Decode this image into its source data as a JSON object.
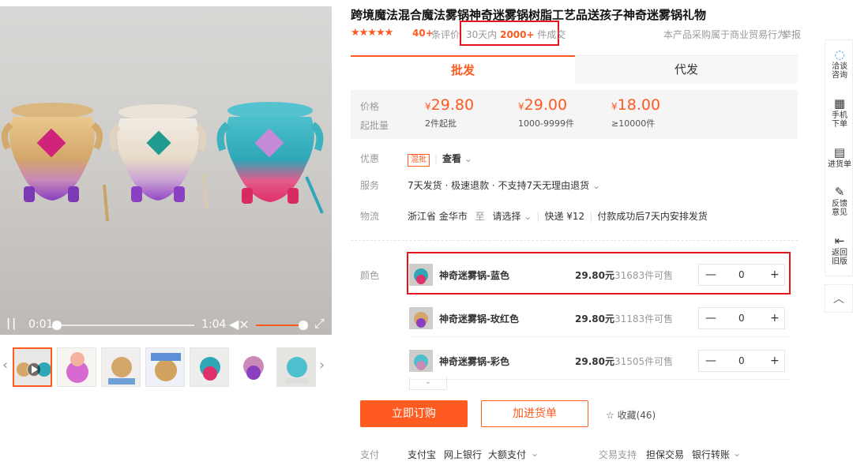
{
  "video": {
    "time_current": "0:01",
    "time_total": "1:04",
    "pause_glyph": "||",
    "volume_glyph": "◀×",
    "fullscreen_glyph": "⤢"
  },
  "thumbnails": {
    "count": 7,
    "prev": "‹",
    "next": "›"
  },
  "product": {
    "title": "跨境魔法混合魔法雾锅神奇迷雾锅树脂工艺品送孩子神奇迷雾锅礼物",
    "stars": "★★★★★",
    "review_count": "40+",
    "review_label": "条评价",
    "sales_prefix": "30天内",
    "sales_count": "2000+",
    "sales_suffix": "件成交",
    "notice": "本产品采购属于商业贸易行为",
    "report": "举报"
  },
  "tabs": {
    "wholesale": "批发",
    "dropship": "代发"
  },
  "pricing": {
    "price_label": "价格",
    "moq_label": "起批量",
    "currency": "¥",
    "tiers": [
      {
        "price": "29.80",
        "qty": "2件起批"
      },
      {
        "price": "29.00",
        "qty": "1000-9999件"
      },
      {
        "price": "18.00",
        "qty": "≥10000件"
      }
    ]
  },
  "promo": {
    "label": "优惠",
    "tag": "混批",
    "view": "查看",
    "chevron": "⌄"
  },
  "service": {
    "label": "服务",
    "text": "7天发货 · 极速退款 · 不支持7天无理由退货",
    "chevron": "⌄"
  },
  "logistics": {
    "label": "物流",
    "origin": "浙江省 金华市",
    "to": "至",
    "select": "请选择",
    "chevron": "⌄",
    "express": "快递 ¥12",
    "ship_note": "付款成功后7天内安排发货"
  },
  "color_label": "颜色",
  "skus": [
    {
      "name": "神奇迷雾锅-蓝色",
      "price": "29.80元",
      "stock": "31683件可售",
      "qty": "0"
    },
    {
      "name": "神奇迷雾锅-玫红色",
      "price": "29.80元",
      "stock": "31183件可售",
      "qty": "0"
    },
    {
      "name": "神奇迷雾锅-彩色",
      "price": "29.80元",
      "stock": "31505件可售",
      "qty": "0"
    }
  ],
  "stepper": {
    "minus": "—",
    "plus": "+"
  },
  "more_chevron": "⌄",
  "actions": {
    "buy": "立即订购",
    "cart": "加进货单",
    "fav_icon": "☆",
    "fav": "收藏(46)"
  },
  "payment": {
    "label": "支付",
    "methods": [
      "支付宝",
      "网上银行",
      "大额支付"
    ],
    "chevron": "⌄",
    "trade_label": "交易支持",
    "trade_items": [
      "担保交易",
      "银行转账"
    ]
  },
  "sidebar": [
    {
      "icon": "◌",
      "line1": "洽谈",
      "line2": "咨询"
    },
    {
      "icon": "▦",
      "line1": "手机",
      "line2": "下单"
    },
    {
      "icon": "▤",
      "line1": "进货单",
      "line2": ""
    },
    {
      "icon": "✎",
      "line1": "反馈",
      "line2": "意见"
    },
    {
      "icon": "⇤",
      "line1": "返回",
      "line2": "旧版"
    }
  ],
  "back_top": "︿",
  "colors": {
    "accent": "#ff5a1f",
    "highlight": "#e4141c",
    "link_blue": "#4a8df0"
  }
}
